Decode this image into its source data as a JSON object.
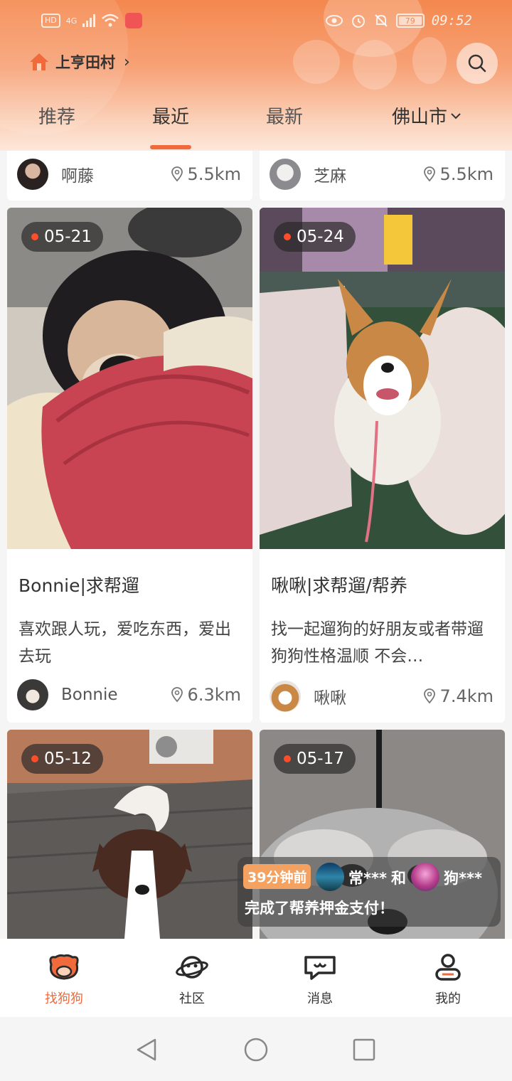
{
  "status_bar": {
    "network": "HD",
    "signal": "4G",
    "battery": "79",
    "time": "09:52"
  },
  "header": {
    "location": "上亨田村",
    "location_chevron": "›",
    "search_icon": "search-icon",
    "tabs": [
      {
        "label": "推荐",
        "active": false
      },
      {
        "label": "最近",
        "active": true
      },
      {
        "label": "最新",
        "active": false
      }
    ],
    "city": "佛山市"
  },
  "feed": {
    "top_row": [
      {
        "user": "啊藤",
        "distance": "5.5km"
      },
      {
        "user": "芝麻",
        "distance": "5.5km"
      }
    ],
    "cards": [
      {
        "date": "05-21",
        "title": "Bonnie|求帮遛",
        "description": "喜欢跟人玩，爱吃东西，爱出去玩",
        "user": "Bonnie",
        "distance": "6.3km"
      },
      {
        "date": "05-24",
        "title": "啾啾|求帮遛/帮养",
        "description": "找一起遛狗的好朋友或者带遛 狗狗性格温顺 不会…",
        "user": "啾啾",
        "distance": "7.4km"
      },
      {
        "date": "05-12"
      },
      {
        "date": "05-17"
      }
    ]
  },
  "toast": {
    "time_ago": "39分钟前",
    "user_a": "常***",
    "conjunction": "和",
    "user_b": "狗***",
    "message": "完成了帮养押金支付！"
  },
  "bottom_nav": [
    {
      "label": "找狗狗",
      "icon": "dog-face-icon",
      "active": true
    },
    {
      "label": "社区",
      "icon": "planet-icon",
      "active": false
    },
    {
      "label": "消息",
      "icon": "chat-bubble-icon",
      "active": false
    },
    {
      "label": "我的",
      "icon": "profile-icon",
      "active": false
    }
  ],
  "colors": {
    "accent": "#f06a3c",
    "header_top": "#f4884e",
    "toast_badge": "#f3a261"
  }
}
